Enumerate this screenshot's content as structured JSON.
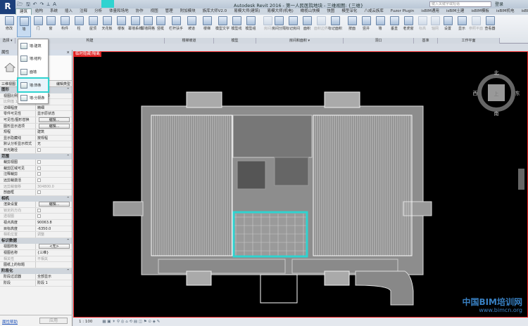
{
  "app": {
    "title": "Autodesk Revit 2016 -   第一人民医院地块 - 三维视图: {三维}",
    "logo": "R",
    "search_placeholder": "键入关键字或短语",
    "sign_in": "登录"
  },
  "tabs": [
    "建筑",
    "结构",
    "系统",
    "插入",
    "注释",
    "分析",
    "体量和场地",
    "协作",
    "视图",
    "管理",
    "附加模块",
    "族库大师V2.0",
    "易模大师(建筑)",
    "易模大师(机电)",
    "橄榄山快模",
    "快图",
    "模型深化",
    "八戒云族库",
    "Fuzor Plugin",
    "isBIM通用",
    "isBIM土建",
    "isBIM模板",
    "isBIM机电",
    "isBIM出图"
  ],
  "ribbon": {
    "buttons": [
      "修改",
      "墙",
      "门",
      "窗",
      "构件",
      "柱",
      "屋顶",
      "天花板",
      "楼板",
      "幕墙系统",
      "幕墙网格",
      "竖梃",
      "栏杆扶手",
      "坡道",
      "楼梯",
      "模型文字",
      "模型线",
      "模型组",
      "房间",
      "房间分隔",
      "标记房间",
      "面积",
      "面积边界",
      "标记面积",
      "按面",
      "竖井",
      "墙",
      "垂直",
      "老虎窗",
      "标高",
      "轴网",
      "设置",
      "显示",
      "参照平面",
      "查看器"
    ],
    "panels": [
      "选择 ▾",
      "构建",
      "楼梯坡道",
      "模型",
      "房间和面积 ▾",
      "洞口",
      "基准",
      "工作平面"
    ]
  },
  "wall_menu": [
    "墙:建筑",
    "墙:结构",
    "面墙",
    "墙:饰条",
    "墙:分隔条"
  ],
  "properties": {
    "title": "属性",
    "close": "×",
    "type_name": "三维视图: {三维}",
    "type_short": "三维视图",
    "edit_type": "编辑类型",
    "sections": [
      {
        "name": "图形",
        "rows": [
          [
            "视图比例",
            "1 : 100"
          ],
          [
            "比例值 1:",
            "100"
          ],
          [
            "详细程度",
            "精细"
          ],
          [
            "零件可见性",
            "显示原状态"
          ],
          [
            "可见性/图形替换",
            "编辑..."
          ],
          [
            "图形显示选项",
            "编辑..."
          ],
          [
            "规程",
            "建筑"
          ],
          [
            "显示隐藏线",
            "按规程"
          ],
          [
            "默认分析显示样式",
            "无"
          ],
          [
            "日光路径",
            ""
          ]
        ]
      },
      {
        "name": "范围",
        "rows": [
          [
            "裁剪视图",
            ""
          ],
          [
            "裁剪区域可见",
            ""
          ],
          [
            "注释裁剪",
            ""
          ],
          [
            "远剪裁激活",
            ""
          ],
          [
            "远剪裁偏移",
            "304800.0"
          ],
          [
            "剖面框",
            ""
          ]
        ]
      },
      {
        "name": "相机",
        "rows": [
          [
            "渲染设置",
            "编辑..."
          ],
          [
            "锁定的方向",
            ""
          ],
          [
            "透视图",
            ""
          ],
          [
            "视点高度",
            "90063.8"
          ],
          [
            "目标高度",
            "-6350.0"
          ],
          [
            "相机位置",
            "调整"
          ]
        ]
      },
      {
        "name": "标识数据",
        "rows": [
          [
            "视图样板",
            "<无>"
          ],
          [
            "视图名称",
            "{三维}"
          ],
          [
            "相关性",
            "不相关"
          ],
          [
            "图纸上的标题",
            ""
          ]
        ]
      },
      {
        "name": "阶段化",
        "rows": [
          [
            "阶段过滤器",
            "全部显示"
          ],
          [
            "阶段",
            "阶段 1"
          ]
        ]
      }
    ],
    "help": "属性帮助",
    "apply": "应用"
  },
  "view": {
    "label": "临时隐藏/隔离",
    "compass": {
      "n": "北",
      "e": "东",
      "s": "南",
      "w": "西",
      "face": "上"
    }
  },
  "status": {
    "scale": "1 : 100"
  },
  "watermark": {
    "line1": "中国BIM培训网",
    "line2": "www.bimcn.org"
  },
  "colors": {
    "highlight": "#2fd3d0",
    "view_border": "#dd2222"
  }
}
